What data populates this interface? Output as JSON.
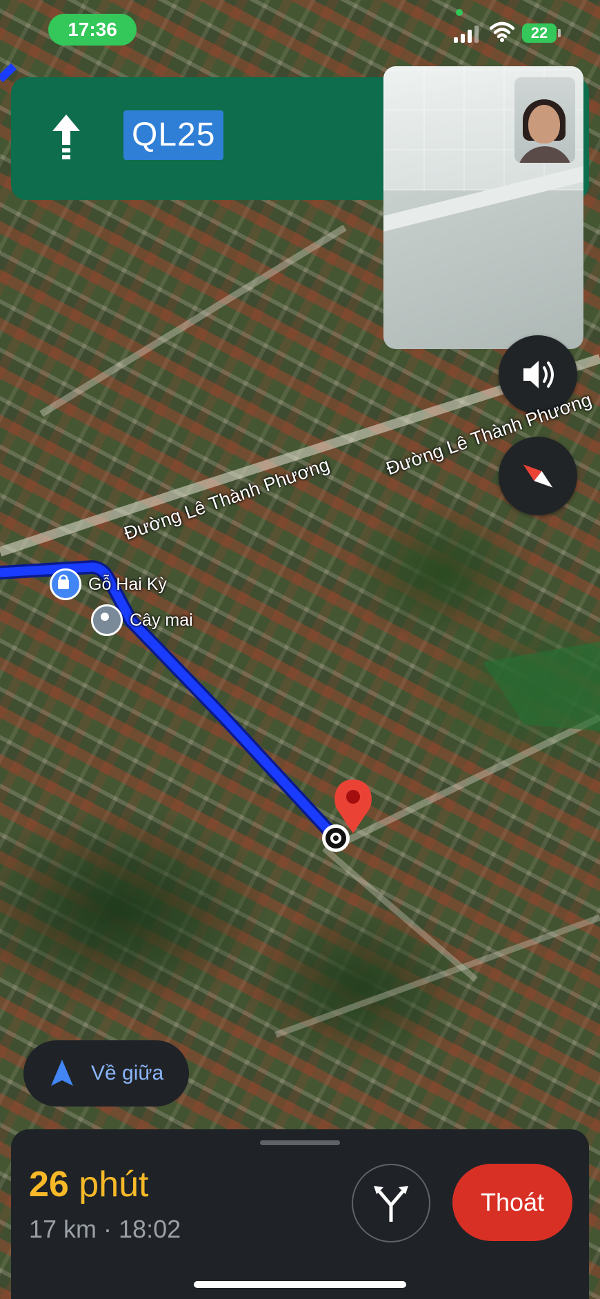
{
  "status_bar": {
    "time": "17:36",
    "battery": "22"
  },
  "banner": {
    "direction_icon": "straight-arrow-icon",
    "route_badge": "QL25"
  },
  "map": {
    "road_labels": [
      "Đường Lê Thành Phương",
      "Đường Lê Thành Phương"
    ],
    "pois": [
      {
        "label": "Gỗ Hai Kỳ",
        "icon": "shopping-bag-pin-icon",
        "color": "#4285f4"
      },
      {
        "label": "Cây mai",
        "icon": "location-pin-icon",
        "color": "#7b8a99"
      }
    ],
    "route_color": "#1a3cff",
    "destination_pin_color": "#ea4335"
  },
  "controls": {
    "recenter_label": "Về giữa",
    "recenter_icon": "navigation-arrow-icon",
    "sound_icon": "speaker-icon",
    "compass_icon": "compass-icon"
  },
  "trip": {
    "eta_number": "26",
    "eta_unit": "phút",
    "details": "17 km · 18:02",
    "alt_routes_icon": "alternate-routes-icon",
    "exit_label": "Thoát",
    "eta_color": "#f7b928",
    "exit_color": "#d93025"
  }
}
